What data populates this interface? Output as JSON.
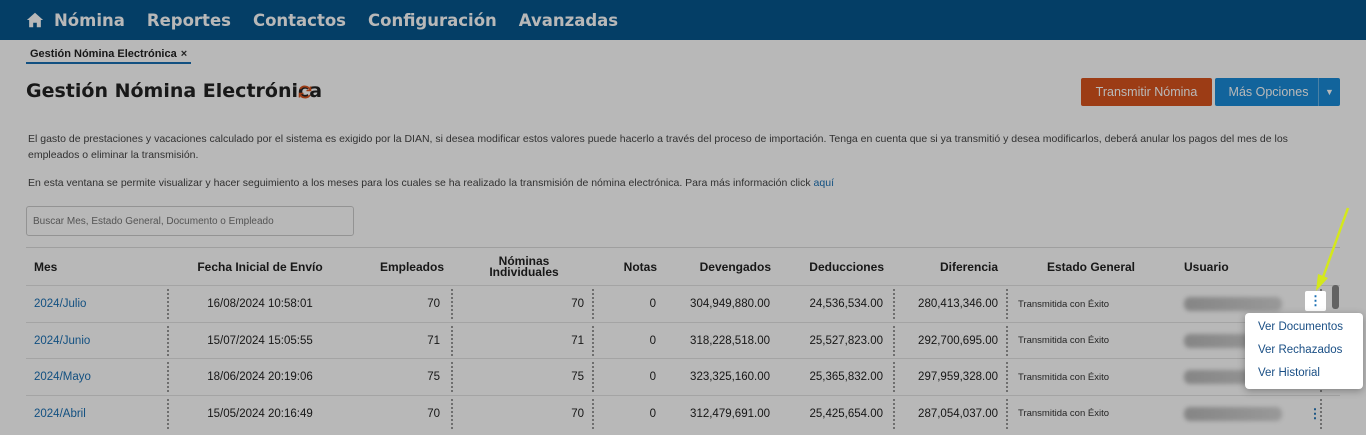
{
  "nav": {
    "items": [
      "Nómina",
      "Reportes",
      "Contactos",
      "Configuración",
      "Avanzadas"
    ]
  },
  "tab": {
    "label": "Gestión Nómina Electrónica",
    "close": "×"
  },
  "page": {
    "title": "Gestión Nómina Electrónica",
    "transmit_label": "Transmitir Nómina",
    "more_label": "Más Opciones",
    "info1": "El gasto de prestaciones y vacaciones calculado por el sistema es exigido por la DIAN, si desea modificar estos valores puede hacerlo a través del proceso de importación. Tenga en cuenta que si ya transmitió y desea modificarlos, deberá anular los pagos del mes de los empleados o eliminar la transmisión.",
    "info2": "En esta ventana se permite visualizar y hacer seguimiento a los meses para los cuales se ha realizado la transmisión de nómina electrónica. Para más información click ",
    "info2_link": "aquí",
    "search_placeholder": "Buscar Mes, Estado General, Documento o Empleado"
  },
  "table": {
    "headers": {
      "mes": "Mes",
      "fecha": "Fecha Inicial de Envío",
      "empleados": "Empleados",
      "nominas": "Nóminas Individuales",
      "notas": "Notas",
      "devengados": "Devengados",
      "deducciones": "Deducciones",
      "diferencia": "Diferencia",
      "estado": "Estado General",
      "usuario": "Usuario"
    },
    "rows": [
      {
        "mes": "2024/Julio",
        "fecha": "16/08/2024 10:58:01",
        "empleados": "70",
        "nominas": "70",
        "notas": "0",
        "devengados": "304,949,880.00",
        "deducciones": "24,536,534.00",
        "diferencia": "280,413,346.00",
        "estado": "Transmitida con Éxito"
      },
      {
        "mes": "2024/Junio",
        "fecha": "15/07/2024 15:05:55",
        "empleados": "71",
        "nominas": "71",
        "notas": "0",
        "devengados": "318,228,518.00",
        "deducciones": "25,527,823.00",
        "diferencia": "292,700,695.00",
        "estado": "Transmitida con Éxito"
      },
      {
        "mes": "2024/Mayo",
        "fecha": "18/06/2024 20:19:06",
        "empleados": "75",
        "nominas": "75",
        "notas": "0",
        "devengados": "323,325,160.00",
        "deducciones": "25,365,832.00",
        "diferencia": "297,959,328.00",
        "estado": "Transmitida con Éxito"
      },
      {
        "mes": "2024/Abril",
        "fecha": "15/05/2024 20:16:49",
        "empleados": "70",
        "nominas": "70",
        "notas": "0",
        "devengados": "312,479,691.00",
        "deducciones": "25,425,654.00",
        "diferencia": "287,054,037.00",
        "estado": "Transmitida con Éxito"
      }
    ]
  },
  "menu": {
    "kebab": "⋮",
    "items": [
      "Ver Documentos",
      "Ver Rechazados",
      "Ver Historial"
    ]
  },
  "colors": {
    "nav_bg": "#06568e",
    "transmit_bg": "#d9541e",
    "more_bg": "#1a8bd8",
    "link": "#1a6fb3",
    "arrow": "#d4e81c"
  }
}
